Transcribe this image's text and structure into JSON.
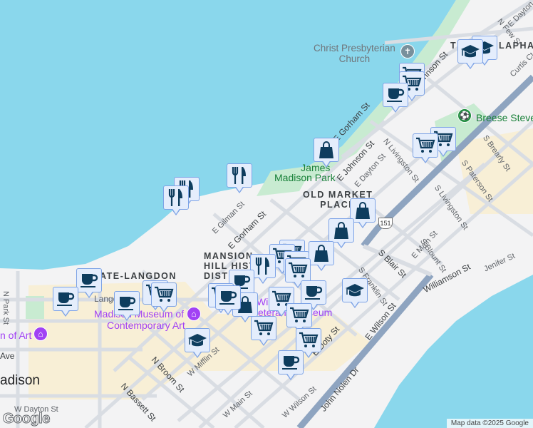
{
  "map": {
    "colors": {
      "water": "#8ad7ec",
      "land": "#f3f3f4",
      "park": "#c8ebd1",
      "highway": "#8ea4c0",
      "road": "#d9dde3",
      "downtown": "#f8efd6",
      "marker_bg": "#e4edfc",
      "marker_border": "#7da3e6",
      "marker_icon": "#0e3d5e"
    },
    "districts": [
      "MANSION HILL HISTORIC DISTRICT",
      "STATE-LANGDON",
      "OLD MARKET PLACE",
      "TENNEY-LAPHAM"
    ],
    "district_visible": {
      "mansion1": "MANSION",
      "mansion2": "HILL HISTO",
      "mansion3": "DISTI",
      "state_langdon": "ATE-LANGDON",
      "omp1": "OLD MARKET",
      "omp2": "PLACE",
      "tl1": "T",
      "tl2": "LAPHAM"
    },
    "pois": {
      "church": "Christ Presbyterian Church",
      "church1": "Christ Presbyterian",
      "church2": "Church",
      "park1": "James",
      "park2": "Madison Park",
      "breese": "Breese Steve",
      "mmoca1": "Madison Museum of",
      "mmoca2": "Contemporary Art",
      "art": "n of Art",
      "wis1": "Wis",
      "wis2": "eterans Museum",
      "langdon": "Langd"
    },
    "streets": [
      "N Few St",
      "E Dayton St",
      "Curtis Ct",
      "E Johnson St",
      "E Gorham St",
      "E Gorham St",
      "E Johnson St",
      "N Livingston St",
      "E Dayton St",
      "S Brearly St",
      "S Paterson St",
      "S Livingston St",
      "E Main St",
      "S Blount St",
      "Jenifer St",
      "Williamson St",
      "S Blair St",
      "S Franklin St",
      "E Wilson St",
      "E Doty St",
      "John Nolen Dr",
      "W Wilson St",
      "W Main St",
      "W Mifflin St",
      "N Broom St",
      "N Bassett St",
      "W Dayton St",
      "N Park St",
      "E Gilman St",
      "Ave",
      "N Park St",
      "N B",
      "Langdon St",
      "Ave"
    ],
    "city": "adison",
    "highway_shield": "151",
    "markers": [
      "grad",
      "grad",
      "cart",
      "cart",
      "cup",
      "cart",
      "cart",
      "bag",
      "utensils",
      "utensils",
      "utensils",
      "bag",
      "bag",
      "bag",
      "cart",
      "cart",
      "cart",
      "utensils",
      "cup",
      "cart",
      "cup",
      "cup",
      "grad",
      "cup",
      "cup",
      "cart",
      "cart",
      "cart",
      "cart",
      "bag",
      "cup",
      "cart",
      "cart",
      "cart",
      "grad",
      "cup"
    ],
    "attribution": "Map data ©2025 Google",
    "logo": "Google"
  }
}
